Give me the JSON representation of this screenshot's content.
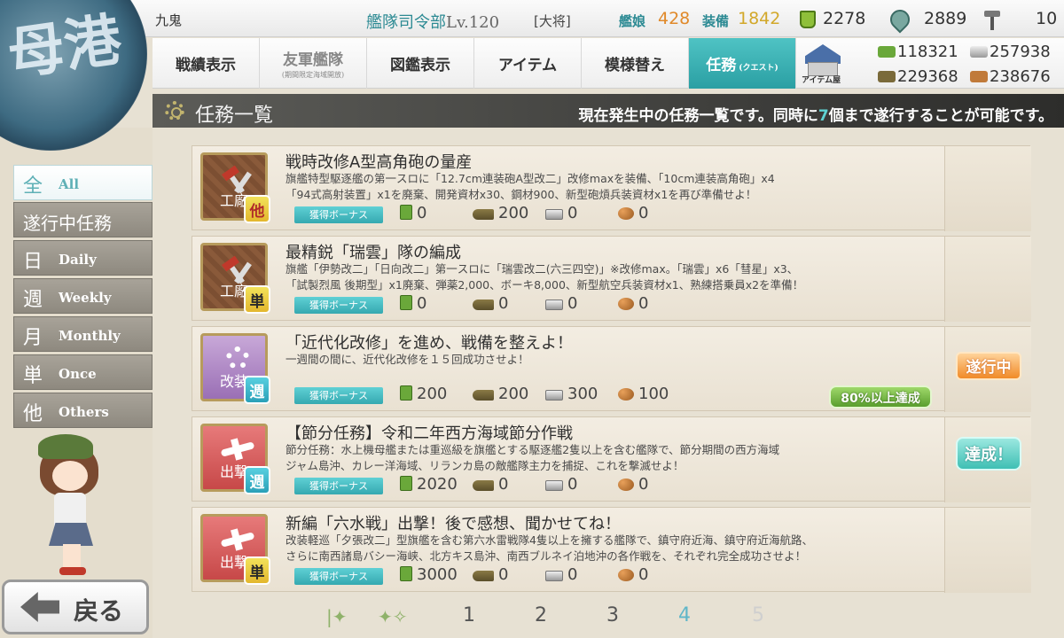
{
  "header": {
    "admiral_name": "九鬼",
    "hq_label": "艦隊司令部",
    "hq_level_prefix": "Lv.",
    "hq_level": "120",
    "rank": "[大将]",
    "ship_label": "艦娘",
    "ship_count": "428",
    "equip_label": "装備",
    "equip_count": "1842",
    "bucket": "2278",
    "dev_material": "2889",
    "screw": "10"
  },
  "nav": {
    "items": [
      {
        "label": "戦績表示"
      },
      {
        "label": "友軍艦隊",
        "sub": "(期間限定海域開放)"
      },
      {
        "label": "図鑑表示"
      },
      {
        "label": "アイテム"
      },
      {
        "label": "模様替え"
      },
      {
        "label": "任務",
        "sub": "(クエスト)"
      }
    ],
    "shop_label": "アイテム屋"
  },
  "materials": {
    "fuel": "118321",
    "steel": "257938",
    "ammo": "229368",
    "bauxite": "238676"
  },
  "title": {
    "text": "任務一覧",
    "desc_before": "現在発生中の任務一覧です。同時に",
    "desc_num": "7",
    "desc_after": "個まで遂行することが可能です。"
  },
  "emblem": {
    "text": "母港"
  },
  "filters": [
    {
      "kanji": "全",
      "en": "All"
    },
    {
      "kanji": "遂行中任務",
      "en": ""
    },
    {
      "kanji": "日",
      "en": "Daily"
    },
    {
      "kanji": "週",
      "en": "Weekly"
    },
    {
      "kanji": "月",
      "en": "Monthly"
    },
    {
      "kanji": "単",
      "en": "Once"
    },
    {
      "kanji": "他",
      "en": "Others"
    }
  ],
  "back_label": "戻る",
  "bonus_label": "獲得ボーナス",
  "quests": [
    {
      "category": "工廠",
      "badge": "他",
      "title": "戦時改修A型高角砲の量産",
      "desc": [
        "旗艦特型駆逐艦の第一スロに「12.7cm連装砲A型改二」改修maxを装備、「10cm連装高角砲」x4",
        "「94式高射装置」x1を廃棄、開発資材x30、鋼材900、新型砲熕兵装資材x1を再び準備せよ！"
      ],
      "fuel": "0",
      "ammo": "200",
      "steel": "0",
      "bauxite": "0"
    },
    {
      "category": "工廠",
      "badge": "単",
      "title": "最精鋭「瑞雲」隊の編成",
      "desc": [
        "旗艦「伊勢改二」「日向改二」第一スロに「瑞雲改二(六三四空)」※改修max。「瑞雲」x6「彗星」x3、",
        "「試製烈風 後期型」x1廃棄、弾薬2,000、ボーキ8,000、新型航空兵装資材x1、熟練搭乗員x2を準備！"
      ],
      "fuel": "0",
      "ammo": "0",
      "steel": "0",
      "bauxite": "0"
    },
    {
      "category": "改装",
      "badge": "週",
      "title": "「近代化改修」を進め、戦備を整えよ！",
      "desc": [
        "一週間の間に、近代化改修を１５回成功させよ！"
      ],
      "fuel": "200",
      "ammo": "200",
      "steel": "300",
      "bauxite": "100",
      "status": "遂行中",
      "progress": "80%以上達成"
    },
    {
      "category": "出撃",
      "badge": "週",
      "title": "【節分任務】令和二年西方海域節分作戦",
      "desc": [
        "節分任務：水上機母艦または重巡級を旗艦とする駆逐艦2隻以上を含む艦隊で、節分期間の西方海域",
        "ジャム島沖、カレー洋海域、リランカ島の敵艦隊主力を捕捉、これを撃滅せよ！"
      ],
      "fuel": "2020",
      "ammo": "0",
      "steel": "0",
      "bauxite": "0",
      "status": "達成！"
    },
    {
      "category": "出撃",
      "badge": "単",
      "title": "新編「六水戦」出撃！後で感想、聞かせてね！",
      "desc": [
        "改装軽巡「夕張改二」型旗艦を含む第六水雷戦隊4隻以上を擁する艦隊で、鎮守府近海、鎮守府近海航路、",
        "さらに南西諸島バシー海峡、北方キス島沖、南西ブルネイ泊地沖の各作戦を、それぞれ完全成功させよ！"
      ],
      "fuel": "3000",
      "ammo": "0",
      "steel": "0",
      "bauxite": "0"
    }
  ],
  "pager": {
    "pages": [
      "1",
      "2",
      "3",
      "4",
      "5"
    ],
    "current": "4"
  }
}
